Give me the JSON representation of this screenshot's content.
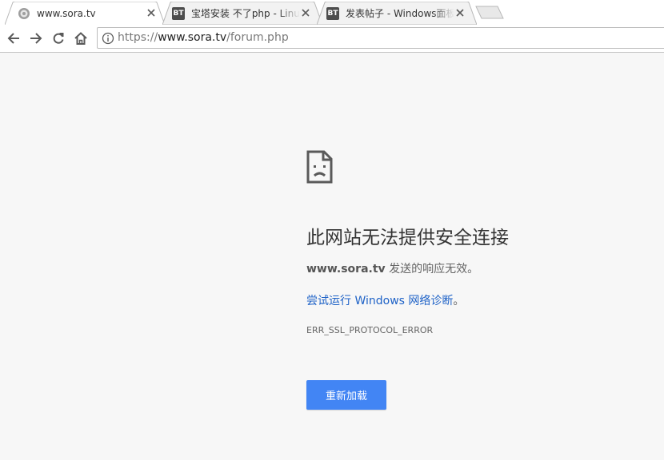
{
  "tabs": [
    {
      "title": "www.sora.tv",
      "favicon": "globe-icon",
      "active": true
    },
    {
      "title": "宝塔安装 不了php - Linux",
      "favicon": "bt-icon",
      "favicon_text": "BT",
      "active": false
    },
    {
      "title": "发表帖子 - Windows面板",
      "favicon": "bt-icon",
      "favicon_text": "BT",
      "active": false
    }
  ],
  "toolbar": {
    "url_proto": "https://",
    "url_host": "www.sora.tv",
    "url_path": "/forum.php"
  },
  "error": {
    "heading": "此网站无法提供安全连接",
    "host": "www.sora.tv",
    "summary_suffix": " 发送的响应无效。",
    "suggest_link": "尝试运行 Windows 网络诊断",
    "suggest_suffix": "。",
    "code": "ERR_SSL_PROTOCOL_ERROR",
    "reload_label": "重新加载"
  },
  "colors": {
    "reload_button": "#4285f4",
    "link": "#1e62c7",
    "page_background": "#f7f7f7"
  }
}
